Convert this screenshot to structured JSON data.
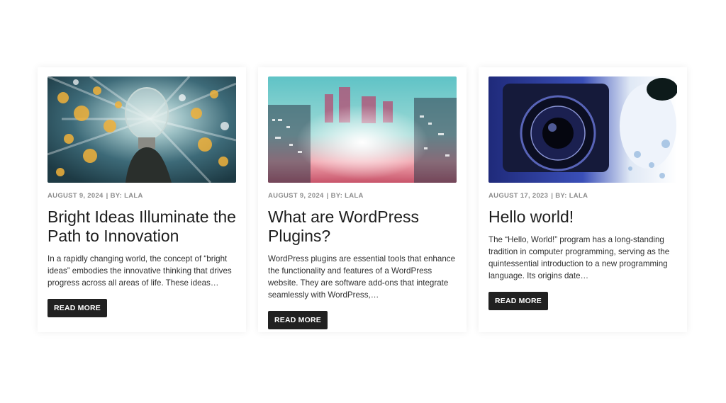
{
  "posts": [
    {
      "image": "lightbulb-bokeh",
      "date": "AUGUST 9, 2024",
      "author": "BY: LALA",
      "title": "Bright Ideas Illuminate the Path to Innovation",
      "excerpt": "In a rapidly changing world, the concept of “bright ideas” embodies the innovative thinking that drives progress across all areas of life. These ideas…",
      "button": "READ MORE"
    },
    {
      "image": "digital-city",
      "date": "AUGUST 9, 2024",
      "author": "BY: LALA",
      "title": "What are WordPress Plugins?",
      "excerpt": "WordPress plugins are essential tools that enhance the functionality and features of a WordPress website. They are software add-ons that integrate seamlessly with WordPress,…",
      "button": "READ MORE"
    },
    {
      "image": "camera-lens",
      "date": "AUGUST 17, 2023",
      "author": "BY: LALA",
      "title": "Hello world!",
      "excerpt": "The “Hello, World!” program has a long-standing tradition in computer programming, serving as the quintessential introduction to a new programming language. Its origins date…",
      "button": "READ MORE"
    }
  ]
}
